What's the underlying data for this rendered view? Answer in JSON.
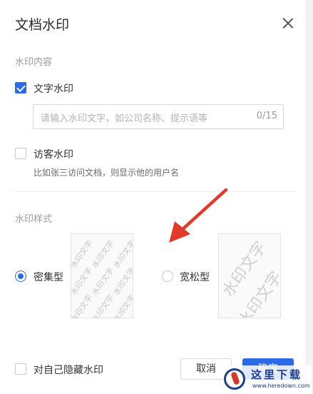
{
  "dialog": {
    "title": "文档水印",
    "content_section_label": "水印内容",
    "text_watermark": {
      "label": "文字水印",
      "checked": true
    },
    "text_input": {
      "placeholder": "请输入水印文字，如公司名称、提示语等",
      "value": "",
      "counter": "0/15"
    },
    "visitor_watermark": {
      "label": "访客水印",
      "checked": false,
      "hint": "比如张三访问文档，则显示他的用户名"
    },
    "style_section_label": "水印样式",
    "styles": [
      {
        "label": "密集型",
        "selected": true,
        "preview_text": "水印文字"
      },
      {
        "label": "宽松型",
        "selected": false,
        "preview_text": "水印文字"
      }
    ],
    "hide_for_self": {
      "label": "对自己隐藏水印",
      "checked": false
    },
    "buttons": {
      "cancel": "取消",
      "confirm": "确定"
    },
    "accent_color": "#2b6be6"
  },
  "site_logo": {
    "name": "这里下载",
    "url": "www.heredown.com"
  }
}
